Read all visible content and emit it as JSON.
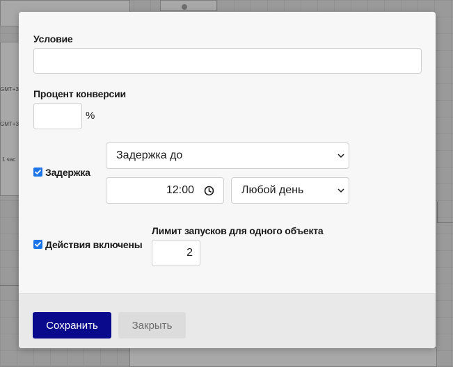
{
  "background": {
    "labels": [
      "GMT+3",
      "GMT+3",
      "1 час"
    ]
  },
  "form": {
    "condition": {
      "label": "Условие",
      "value": ""
    },
    "conversion": {
      "label": "Процент конверсии",
      "value": "",
      "unit": "%"
    },
    "delay": {
      "checkbox_label": "Задержка",
      "checked": true,
      "type_select": "Задержка до",
      "time_value": "12:00",
      "day_select": "Любой день"
    },
    "actions": {
      "checkbox_label": "Действия включены",
      "checked": true
    },
    "launch_limit": {
      "label": "Лимит запусков для одного объекта",
      "value": "2"
    }
  },
  "footer": {
    "save_label": "Сохранить",
    "close_label": "Закрыть"
  },
  "colors": {
    "primary": "#0a0a8c",
    "checkbox": "#1a73e8"
  }
}
